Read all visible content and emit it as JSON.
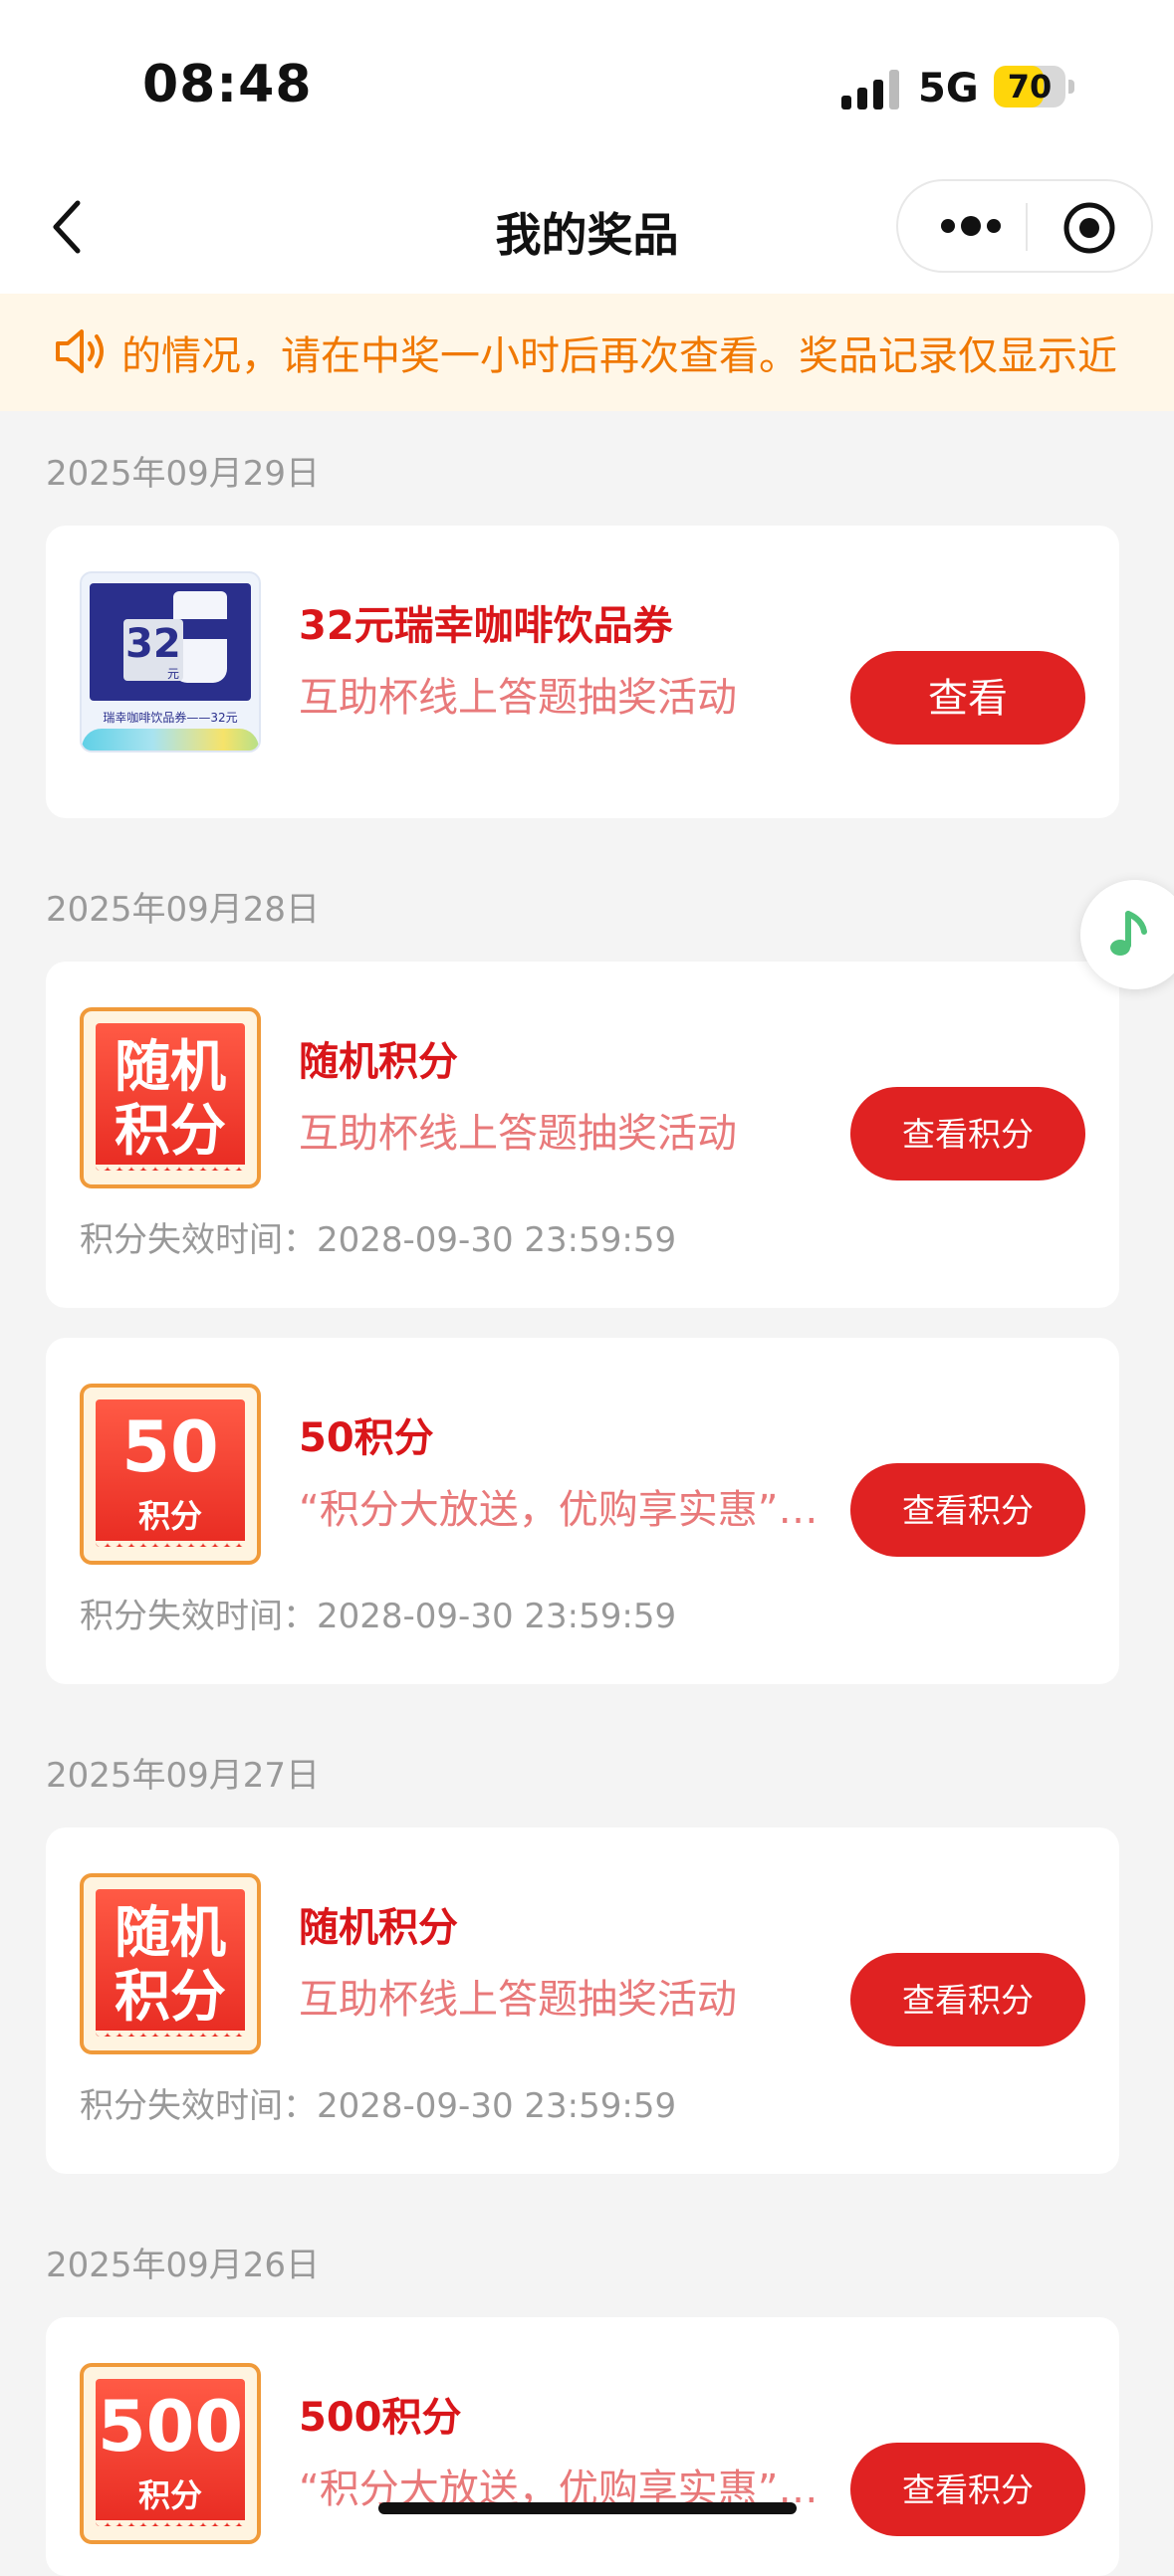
{
  "status": {
    "time": "08:48",
    "network": "5G",
    "battery": "70",
    "battery_level": 0.7
  },
  "nav": {
    "title": "我的奖品"
  },
  "notice": {
    "text": "的情况，请在中奖一小时后再次查看。奖品记录仅显示近"
  },
  "groups": [
    {
      "date": "2025年09月29日",
      "items": [
        {
          "name": "32元瑞幸咖啡饮品券",
          "source": "互助杯线上答题抽奖活动",
          "button": "查看",
          "thumb": {
            "type": "coupon",
            "amount": "32",
            "unit": "元",
            "caption": "瑞幸咖啡饮品券——32元"
          }
        }
      ]
    },
    {
      "date": "2025年09月28日",
      "items": [
        {
          "name": "随机积分",
          "source": "互助杯线上答题抽奖活动",
          "button": "查看积分",
          "expire_label": "积分失效时间：",
          "expire": "2028-09-30 23:59:59",
          "thumb": {
            "type": "random",
            "line1": "随机",
            "line2": "积分"
          }
        },
        {
          "name": "50积分",
          "source": "“积分大放送，优购享实惠”活动",
          "button": "查看积分",
          "expire_label": "积分失效时间：",
          "expire": "2028-09-30 23:59:59",
          "thumb": {
            "type": "points",
            "number": "50",
            "unit": "积分"
          }
        }
      ]
    },
    {
      "date": "2025年09月27日",
      "items": [
        {
          "name": "随机积分",
          "source": "互助杯线上答题抽奖活动",
          "button": "查看积分",
          "expire_label": "积分失效时间：",
          "expire": "2028-09-30 23:59:59",
          "thumb": {
            "type": "random",
            "line1": "随机",
            "line2": "积分"
          }
        }
      ]
    },
    {
      "date": "2025年09月26日",
      "items": [
        {
          "name": "500积分",
          "source": "“积分大放送，优购享实惠”活动",
          "button": "查看积分",
          "thumb": {
            "type": "points",
            "number": "500",
            "unit": "积分"
          }
        }
      ]
    }
  ],
  "colors": {
    "accent": "#e02222",
    "prize_name": "#d9161a",
    "source": "#e8797a",
    "notice_text": "#f07800",
    "notice_bg": "#fff7e8"
  },
  "icons": {
    "back": "chevron-left-icon",
    "more": "more-dots-icon",
    "close": "target-circle-icon",
    "notice": "speaker-icon",
    "music": "music-note-icon"
  }
}
